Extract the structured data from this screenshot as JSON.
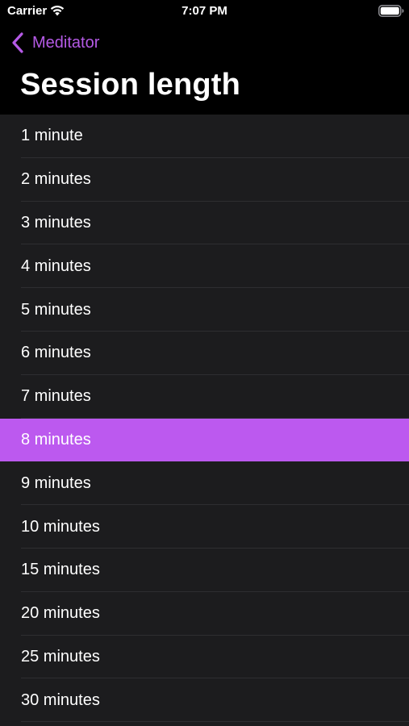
{
  "status_bar": {
    "carrier": "Carrier",
    "time": "7:07 PM",
    "wifi_icon": "wifi-icon",
    "battery_icon": "battery-icon"
  },
  "nav": {
    "back_label": "Meditator",
    "back_icon": "chevron-left-icon",
    "title": "Session length"
  },
  "colors": {
    "accent": "#b55ae6",
    "selected_row": "#bc59ef",
    "list_background": "#1c1c1e",
    "background": "#000000"
  },
  "options": [
    {
      "label": "1 minute",
      "selected": false
    },
    {
      "label": "2 minutes",
      "selected": false
    },
    {
      "label": "3 minutes",
      "selected": false
    },
    {
      "label": "4 minutes",
      "selected": false
    },
    {
      "label": "5 minutes",
      "selected": false
    },
    {
      "label": "6 minutes",
      "selected": false
    },
    {
      "label": "7 minutes",
      "selected": false
    },
    {
      "label": "8 minutes",
      "selected": true
    },
    {
      "label": "9 minutes",
      "selected": false
    },
    {
      "label": "10 minutes",
      "selected": false
    },
    {
      "label": "15 minutes",
      "selected": false
    },
    {
      "label": "20 minutes",
      "selected": false
    },
    {
      "label": "25 minutes",
      "selected": false
    },
    {
      "label": "30 minutes",
      "selected": false
    }
  ]
}
